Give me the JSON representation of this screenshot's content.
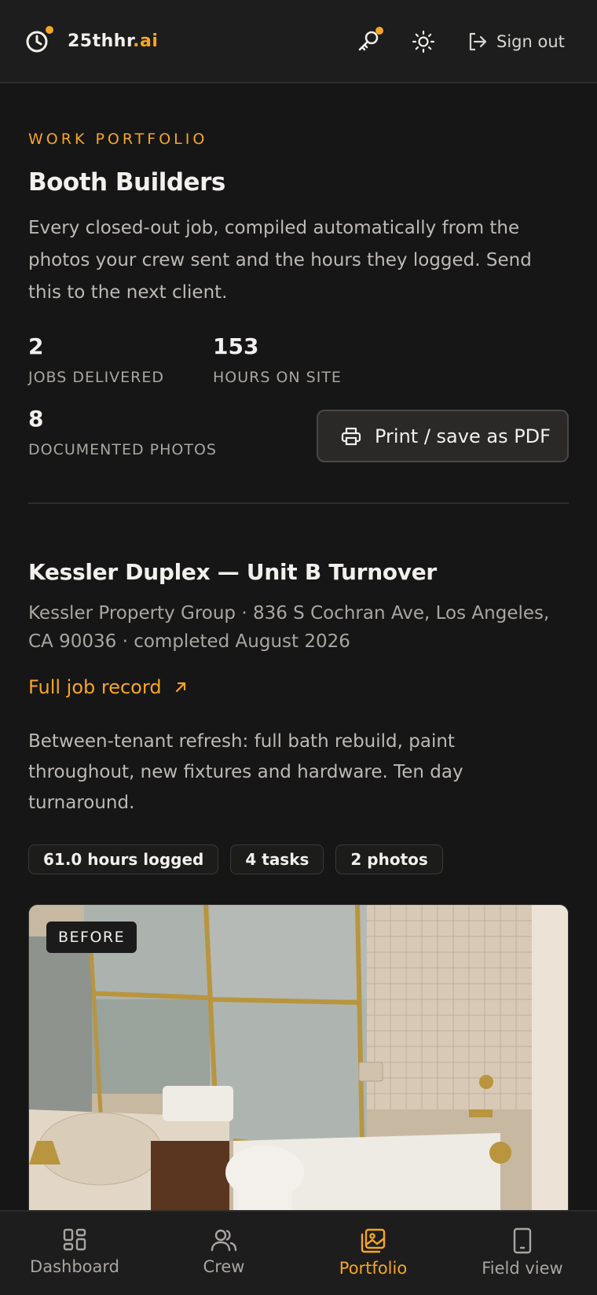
{
  "app": {
    "brand_prefix": "25thhr",
    "brand_suffix": ".ai",
    "sign_out": "Sign out"
  },
  "intro": {
    "eyebrow": "WORK PORTFOLIO",
    "title": "Booth Builders",
    "description": "Every closed-out job, compiled automatically from the photos your crew sent and the hours they logged. Send this to the next client."
  },
  "stats": [
    {
      "value": "2",
      "label": "JOBS DELIVERED"
    },
    {
      "value": "153",
      "label": "HOURS ON SITE"
    },
    {
      "value": "8",
      "label": "DOCUMENTED PHOTOS"
    }
  ],
  "print_label": "Print / save as PDF",
  "job": {
    "title": "Kessler Duplex — Unit B Turnover",
    "meta": "Kessler Property Group · 836 S Cochran Ave, Los Angeles, CA 90036 · completed August 2026",
    "link": "Full job record",
    "description": "Between-tenant refresh: full bath rebuild, paint throughout, new fixtures and hardware. Ten day turnaround.",
    "pills": [
      "61.0 hours logged",
      "4 tasks",
      "2 photos"
    ],
    "photo_badge": "BEFORE"
  },
  "nav": [
    {
      "label": "Dashboard",
      "icon": "grid-icon"
    },
    {
      "label": "Crew",
      "icon": "users-icon"
    },
    {
      "label": "Portfolio",
      "icon": "image-stack-icon",
      "active": true
    },
    {
      "label": "Field view",
      "icon": "phone-icon"
    }
  ],
  "colors": {
    "accent": "#f5a623",
    "background": "#161616",
    "surface": "#1d1d1d"
  }
}
